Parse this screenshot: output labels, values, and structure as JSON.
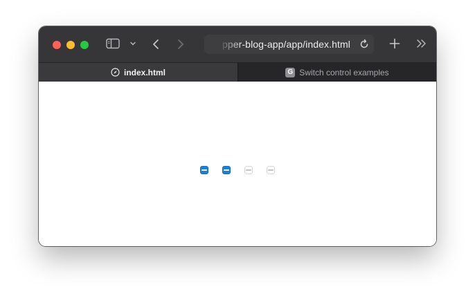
{
  "browser": {
    "url": "pper-blog-app/app/index.html",
    "colors": {
      "titlebar": "#363638",
      "close": "#ff5f57",
      "minimize": "#febc2e",
      "zoom": "#28c840",
      "checkbox_checked": "#1b7fe0"
    },
    "toolbar_icons": [
      "sidebar-icon",
      "chevron-down-icon",
      "back-icon",
      "forward-icon",
      "reload-icon",
      "new-tab-icon",
      "overflow-icon"
    ]
  },
  "tabs": [
    {
      "label": "index.html",
      "icon": "compass-icon",
      "active": true
    },
    {
      "label": "Switch control examples",
      "icon_letter": "G",
      "active": false
    }
  ],
  "page": {
    "checkboxes": [
      {
        "state": "indeterminate",
        "enabled": true
      },
      {
        "state": "indeterminate",
        "enabled": true
      },
      {
        "state": "indeterminate",
        "enabled": false
      },
      {
        "state": "indeterminate",
        "enabled": false
      }
    ]
  }
}
